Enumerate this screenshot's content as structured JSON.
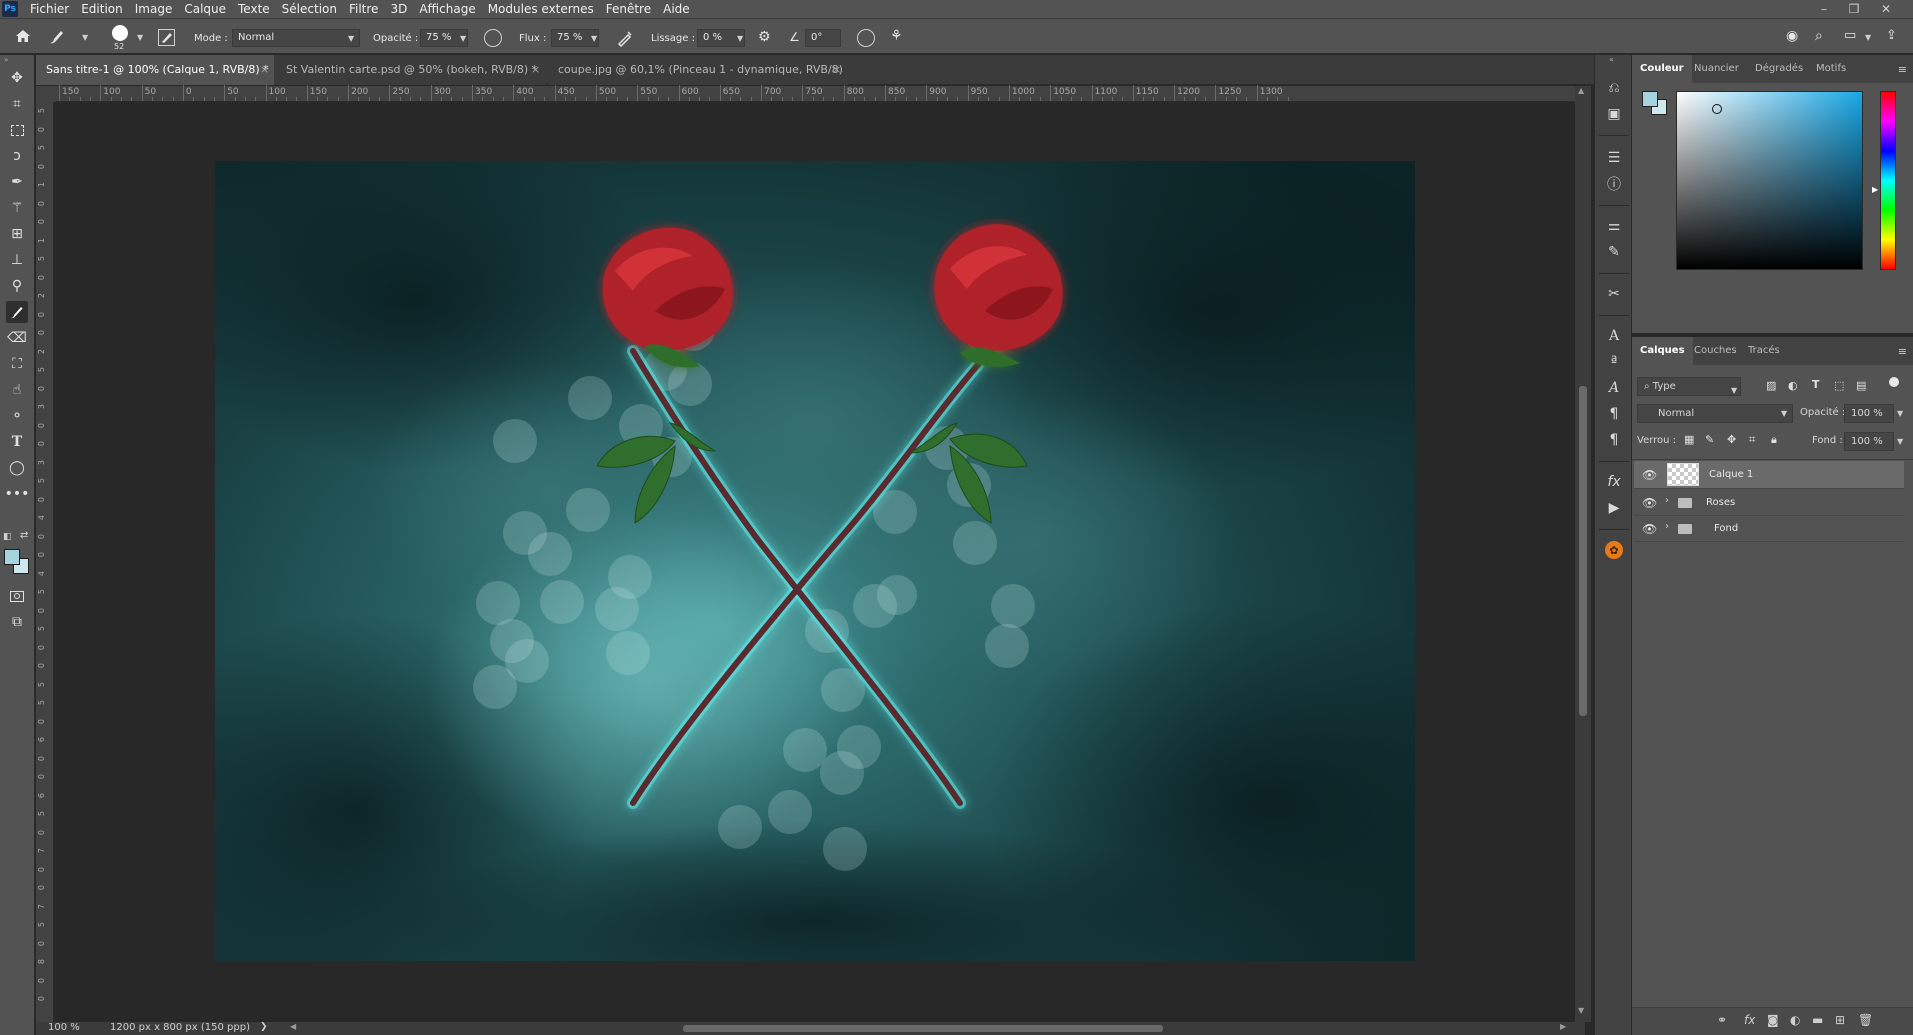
{
  "app": {
    "logo_text": "Ps",
    "menu": [
      "Fichier",
      "Edition",
      "Image",
      "Calque",
      "Texte",
      "Sélection",
      "Filtre",
      "3D",
      "Affichage",
      "Modules externes",
      "Fenêtre",
      "Aide"
    ],
    "window_controls": [
      "–",
      "❐",
      "✕"
    ]
  },
  "options_bar": {
    "brush_size": "52",
    "mode_label": "Mode :",
    "mode_value": "Normal",
    "opacity_label": "Opacité :",
    "opacity_value": "75 %",
    "flow_label": "Flux :",
    "flow_value": "75 %",
    "smoothing_label": "Lissage :",
    "smoothing_value": "0 %",
    "angle_value": "0°"
  },
  "tabs": [
    {
      "label": "Sans titre-1 @ 100% (Calque 1, RVB/8) *",
      "active": true
    },
    {
      "label": "St Valentin carte.psd @ 50% (bokeh, RVB/8) *",
      "active": false
    },
    {
      "label": "coupe.jpg @ 60,1% (Pinceau 1 - dynamique, RVB/8) *",
      "active": false
    }
  ],
  "rulers": {
    "horizontal": [
      "150",
      "100",
      "50",
      "0",
      "50",
      "100",
      "150",
      "200",
      "250",
      "300",
      "350",
      "400",
      "450",
      "500",
      "550",
      "600",
      "650",
      "700",
      "750",
      "800",
      "850",
      "900",
      "950",
      "1000",
      "1050",
      "1100",
      "1150",
      "1200",
      "1250",
      "1300"
    ],
    "vertical": [
      "5",
      "0",
      "5",
      "0",
      "1",
      "0",
      "0",
      "1",
      "5",
      "0",
      "2",
      "0",
      "0",
      "2",
      "5",
      "0",
      "3",
      "0",
      "0",
      "3",
      "5",
      "0",
      "4",
      "0",
      "0",
      "4",
      "5",
      "0",
      "5",
      "0",
      "0",
      "5",
      "5",
      "0",
      "6",
      "0",
      "0",
      "6",
      "5",
      "0",
      "7",
      "0",
      "0",
      "7",
      "5",
      "0",
      "8",
      "0",
      "0"
    ]
  },
  "status": {
    "zoom": "100 %",
    "doc_info": "1200 px x 800 px (150 ppp)",
    "arrow": "❯"
  },
  "color_panel": {
    "tabs": [
      "Couleur",
      "Nuancier",
      "Dégradés",
      "Motifs"
    ],
    "foreground": "#a6d3e0",
    "background": "#cfe8f0",
    "picker_hue": "#1aa7e6"
  },
  "layers_panel": {
    "tabs": [
      "Calques",
      "Couches",
      "Tracés"
    ],
    "filter_label": "Type",
    "blend_mode": "Normal",
    "opacity_label": "Opacité :",
    "opacity_value": "100 %",
    "lock_label": "Verrou :",
    "fill_label": "Fond :",
    "fill_value": "100 %",
    "layers": [
      {
        "name": "Calque 1",
        "type": "pixel",
        "selected": true
      },
      {
        "name": "Roses",
        "type": "group",
        "selected": false
      },
      {
        "name": "Fond",
        "type": "group",
        "selected": false
      }
    ],
    "footer_icons": [
      "link-icon",
      "fx-icon",
      "mask-icon",
      "adjustment-icon",
      "group-icon",
      "new-layer-icon",
      "trash-icon"
    ],
    "footer_fx": "fx"
  },
  "colors": {
    "ui_bg": "#535353",
    "ui_dark": "#282828",
    "teal_glow": "#3fd8d8",
    "rose_red": "#b0202a",
    "leaf_green": "#2f6e2c"
  }
}
